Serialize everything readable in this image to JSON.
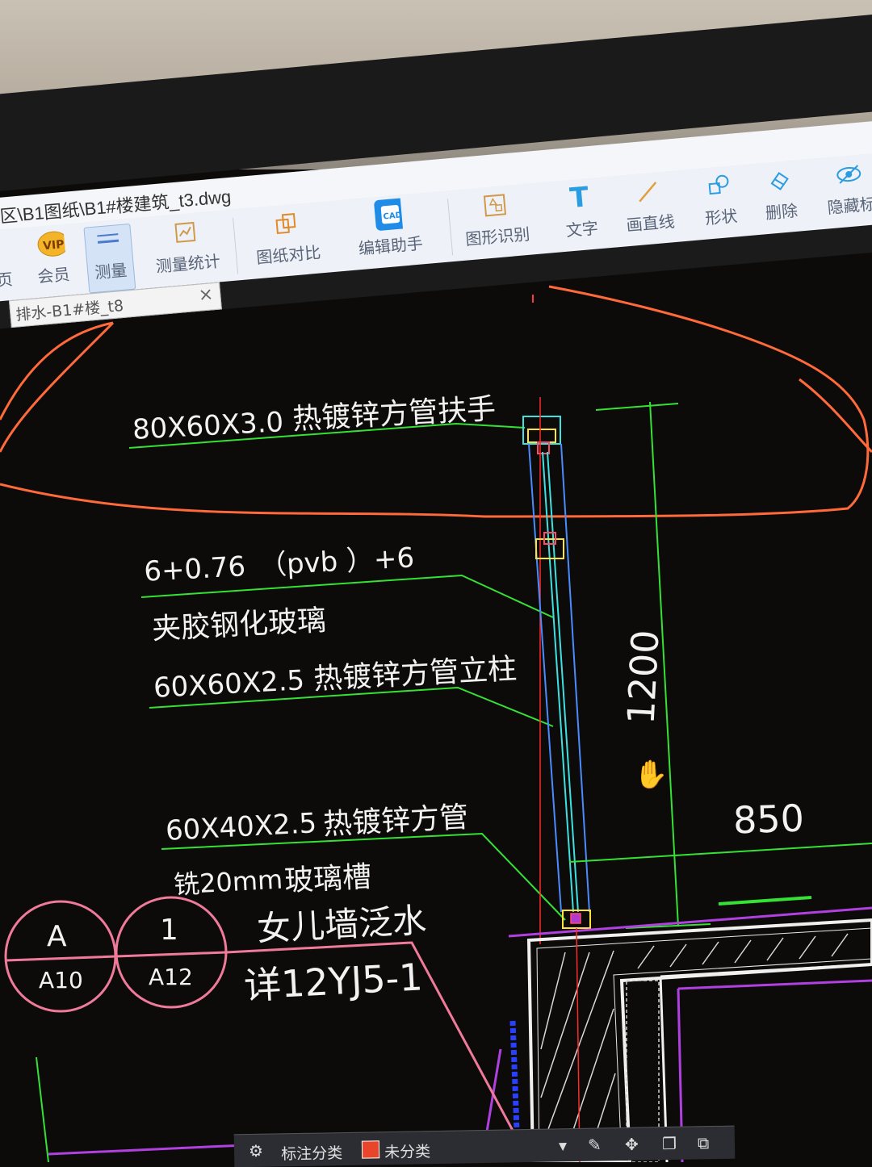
{
  "window": {
    "title": "区\\B1图纸\\B1#楼建筑_t3.dwg"
  },
  "ribbon": {
    "items": [
      {
        "label": "页",
        "icon": "page-icon"
      },
      {
        "label": "会员",
        "icon": "vip-icon",
        "badge": "VIP"
      },
      {
        "label": "测量",
        "icon": "measure-icon",
        "active": true
      },
      {
        "label": "测量统计",
        "icon": "measure-stats-icon"
      },
      {
        "label": "图纸对比",
        "icon": "compare-icon"
      },
      {
        "label": "编辑助手",
        "icon": "cad-edit-icon",
        "badge": "CAD"
      },
      {
        "label": "图形识别",
        "icon": "shape-recognize-icon"
      },
      {
        "label": "文字",
        "icon": "text-icon"
      },
      {
        "label": "画直线",
        "icon": "line-icon"
      },
      {
        "label": "形状",
        "icon": "shape-icon"
      },
      {
        "label": "删除",
        "icon": "eraser-icon"
      },
      {
        "label": "隐藏标",
        "icon": "eye-icon"
      }
    ]
  },
  "doc_tab": {
    "label": "排水-B1#楼_t8",
    "close": "×"
  },
  "drawing": {
    "handrail_spec": "80X60X3.0",
    "handrail_name": "热镀锌方管扶手",
    "glass_spec": "6+0.76　（pvb ）+6",
    "glass_name": "夹胶钢化玻璃",
    "post_spec": "60X60X2.5",
    "post_name": "热镀锌方管立柱",
    "base_spec": "60X40X2.5",
    "base_name": "热镀锌方管",
    "groove_spec": "铣20mm",
    "groove_name": "玻璃槽",
    "parapet_note": "女儿墙泛水",
    "detail_ref": "详12YJ5-1",
    "height_dim": "1200",
    "width_dim": "850",
    "callout_a_top": "A",
    "callout_a_bottom": "A10",
    "callout_1_top": "1",
    "callout_1_bottom": "A12"
  },
  "bottom_bar": {
    "category_label": "标注分类",
    "uncategorized_label": "未分类"
  },
  "colors": {
    "cad_background": "#0c0b0a",
    "leader_green": "#35e135",
    "cloud_orange": "#ff6a3a",
    "callout_pink": "#f07a9a",
    "glass_blue": "#4a8cff",
    "cyan": "#3fe0e0",
    "wall_white": "#f0f0f0"
  }
}
